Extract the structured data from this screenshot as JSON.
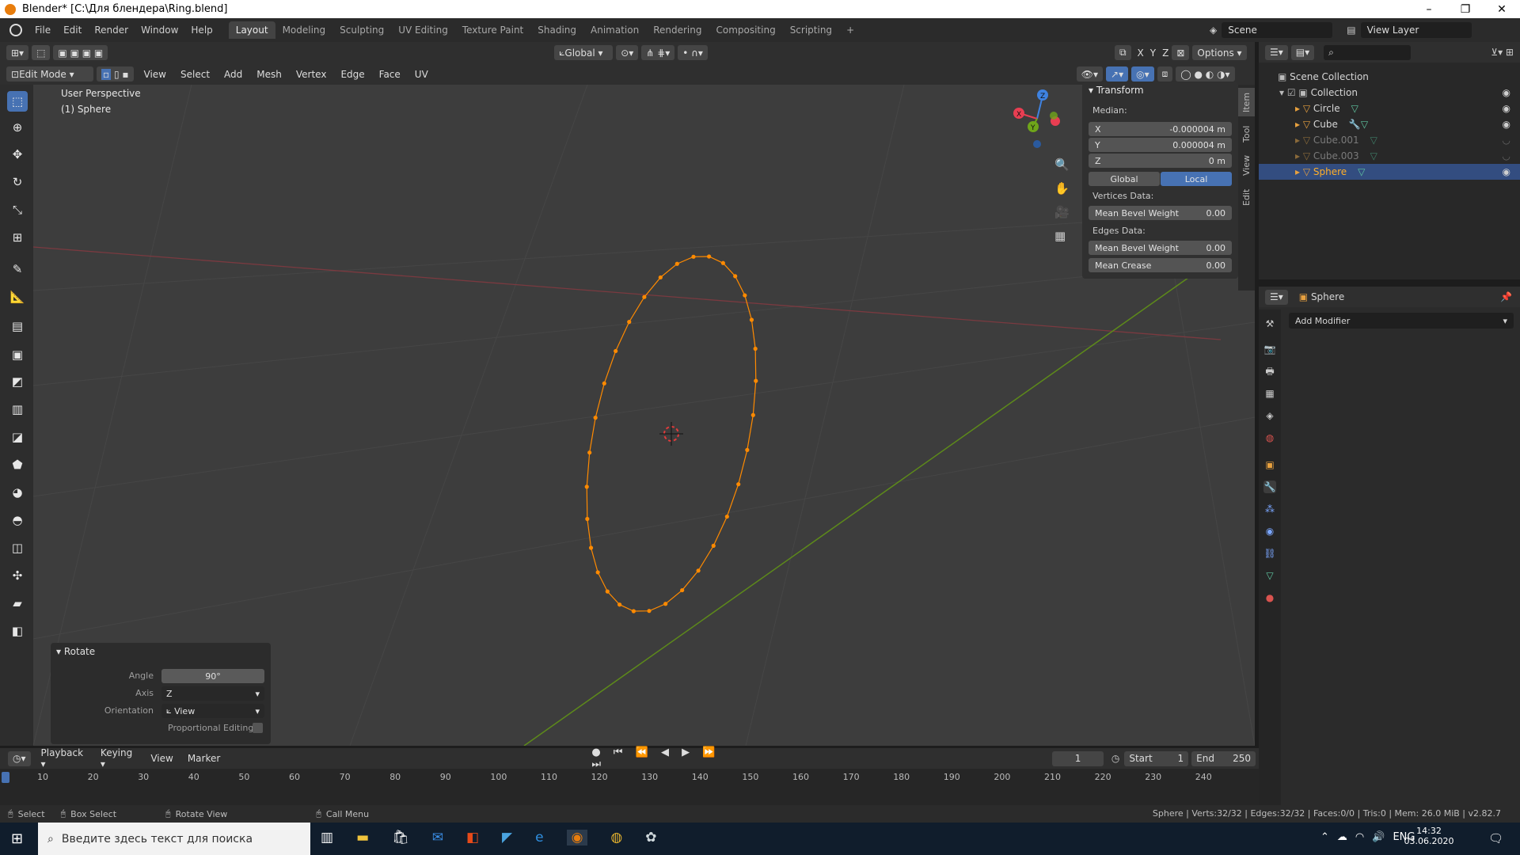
{
  "window": {
    "title": "Blender* [C:\\Для блендера\\Ring.blend]",
    "minimize": "–",
    "maximize": "❐",
    "close": "✕"
  },
  "topbar": {
    "menus": [
      "File",
      "Edit",
      "Render",
      "Window",
      "Help"
    ],
    "workspaces": [
      "Layout",
      "Modeling",
      "Sculpting",
      "UV Editing",
      "Texture Paint",
      "Shading",
      "Animation",
      "Rendering",
      "Compositing",
      "Scripting"
    ],
    "add_tab": "+",
    "scene": "Scene",
    "view_layer": "View Layer"
  },
  "viewport_header": {
    "mode": "Edit Mode",
    "menus": [
      "View",
      "Select",
      "Add",
      "Mesh",
      "Vertex",
      "Edge",
      "Face",
      "UV"
    ],
    "transform_orientation": "Global",
    "axes": [
      "X",
      "Y",
      "Z"
    ],
    "options": "Options"
  },
  "viewport": {
    "perspective": "User Perspective",
    "object": "(1) Sphere",
    "gizmo_axes": [
      "X",
      "Y",
      "Z"
    ]
  },
  "npanel": {
    "tabs": [
      "Item",
      "Tool",
      "View",
      "Edit"
    ],
    "title": "Transform",
    "median_label": "Median:",
    "x_label": "X",
    "x_value": "-0.000004 m",
    "y_label": "Y",
    "y_value": "0.000004 m",
    "z_label": "Z",
    "z_value": "0 m",
    "global": "Global",
    "local": "Local",
    "vertices_data": "Vertices Data:",
    "vert_bevel_label": "Mean Bevel Weight",
    "vert_bevel_value": "0.00",
    "edges_data": "Edges Data:",
    "edge_bevel_label": "Mean Bevel Weight",
    "edge_bevel_value": "0.00",
    "crease_label": "Mean Crease",
    "crease_value": "0.00"
  },
  "rotate_panel": {
    "title": "Rotate",
    "angle_label": "Angle",
    "angle_value": "90°",
    "axis_label": "Axis",
    "axis_value": "Z",
    "orientation_label": "Orientation",
    "orientation_value": "View",
    "proportional_label": "Proportional Editing"
  },
  "outliner": {
    "root": "Scene Collection",
    "collection": "Collection",
    "items": [
      "Circle",
      "Cube",
      "Cube.001",
      "Cube.003",
      "Sphere"
    ]
  },
  "properties": {
    "object_name": "Sphere",
    "add_modifier": "Add Modifier"
  },
  "timeline": {
    "menus": [
      "Playback",
      "Keying",
      "View",
      "Marker"
    ],
    "current_frame": "1",
    "start_label": "Start",
    "start_value": "1",
    "end_label": "End",
    "end_value": "250",
    "ticks": [
      "10",
      "20",
      "30",
      "40",
      "50",
      "60",
      "70",
      "80",
      "90",
      "100",
      "110",
      "120",
      "130",
      "140",
      "150",
      "160",
      "170",
      "180",
      "190",
      "200",
      "210",
      "220",
      "230",
      "240"
    ]
  },
  "statusbar": {
    "select": "Select",
    "box_select": "Box Select",
    "rotate_view": "Rotate View",
    "call_menu": "Call Menu",
    "stats": "Sphere | Verts:32/32 | Edges:32/32 | Faces:0/0 | Tris:0 | Mem: 26.0 MiB | v2.82.7"
  },
  "taskbar": {
    "search_placeholder": "Введите здесь текст для поиска",
    "lang": "ENG",
    "time": "14:32",
    "date": "03.06.2020"
  },
  "colors": {
    "accent": "#4772b3",
    "vertex": "#ff8a00",
    "x_axis": "#e83e52",
    "y_axis": "#6fa51a",
    "z_axis": "#3e82e0"
  }
}
